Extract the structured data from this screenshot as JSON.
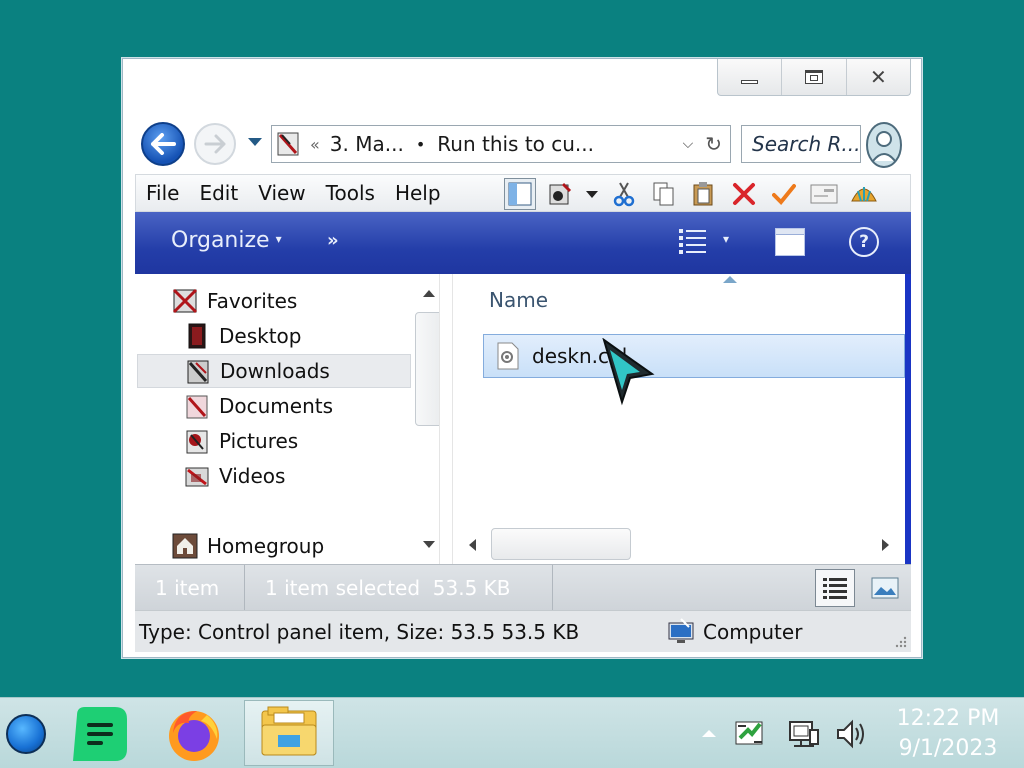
{
  "window": {
    "caption_buttons": [
      "minimize-icon",
      "maximize-icon",
      "close-icon"
    ]
  },
  "nav": {
    "address": {
      "segment_chevron": "«",
      "segments": [
        "3. Ma...",
        "Run this to cu..."
      ],
      "separator": "•"
    },
    "search": {
      "placeholder": "Search R..."
    }
  },
  "menubar": {
    "items": [
      "File",
      "Edit",
      "View",
      "Tools",
      "Help"
    ],
    "toolbar_icons": [
      "preview-pane-icon",
      "properties-icon",
      "dropdown-icon",
      "cut-icon",
      "copy-icon",
      "paste-icon",
      "delete-icon",
      "checkmark-icon",
      "mail-icon",
      "shell-icon"
    ]
  },
  "commandbar": {
    "organize": "Organize",
    "more": "»",
    "help": "?"
  },
  "navpane": {
    "items": [
      {
        "label": "Favorites",
        "icon": "favorites-icon"
      },
      {
        "label": "Desktop",
        "icon": "desktop-icon"
      },
      {
        "label": "Downloads",
        "icon": "downloads-icon",
        "selected": true
      },
      {
        "label": "Documents",
        "icon": "documents-icon"
      },
      {
        "label": "Pictures",
        "icon": "pictures-icon"
      },
      {
        "label": "Videos",
        "icon": "videos-icon"
      },
      {
        "label": "Homegroup",
        "icon": "homegroup-icon"
      }
    ]
  },
  "filepane": {
    "column_header": "Name",
    "files": [
      {
        "name": "deskn.cpl",
        "icon": "control-panel-file-icon",
        "selected": true
      }
    ]
  },
  "statusbar": {
    "item_count": "1 item",
    "selection": "1 item selected  53.5 KB"
  },
  "detailsbar": {
    "text": "Type: Control panel item, Size: 53.5 53.5 KB",
    "zone": "Computer"
  },
  "taskbar": {
    "apps": [
      "notes-app",
      "firefox",
      "file-explorer"
    ],
    "time": "12:22 PM",
    "date": "9/1/2023"
  },
  "colors": {
    "desktop": "#0a8180",
    "command_bar": "#243ea9",
    "selection": "#c9e0f8",
    "taskbar": "#c5dfe1"
  }
}
